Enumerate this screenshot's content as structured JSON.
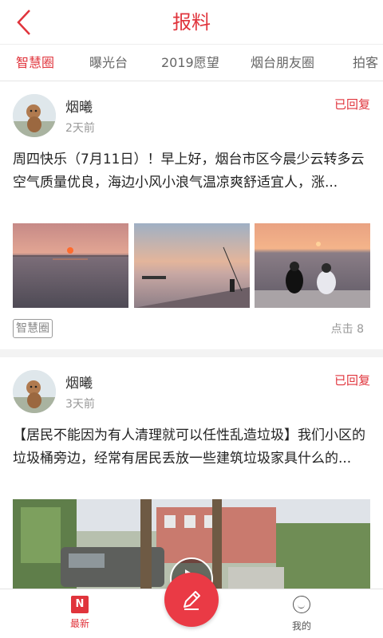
{
  "header": {
    "title": "报料",
    "accent": "#e0343c"
  },
  "tabs": [
    "智慧圈",
    "曝光台",
    "2019愿望",
    "烟台朋友圈",
    "拍客"
  ],
  "active_tab": 0,
  "posts": [
    {
      "author": "烟曦",
      "time": "2天前",
      "status": "已回复",
      "content": "周四快乐（7月11日）！早上好，烟台市区今晨少云转多云空气质量优良，海边小风小浪气温凉爽舒适宜人，涨...",
      "tag": "智慧圈",
      "clicks": "点击 8"
    },
    {
      "author": "烟曦",
      "time": "3天前",
      "status": "已回复",
      "content": "【居民不能因为有人清理就可以任性乱造垃圾】我们小区的垃圾桶旁边，经常有居民丢放一些建筑垃圾家具什么的..."
    }
  ],
  "bottom_nav": {
    "latest": "最新",
    "latest_icon": "N",
    "mine": "我的"
  },
  "icons": {
    "back": "chevron-left-icon",
    "compose": "pencil-icon",
    "mine": "smiley-icon"
  }
}
